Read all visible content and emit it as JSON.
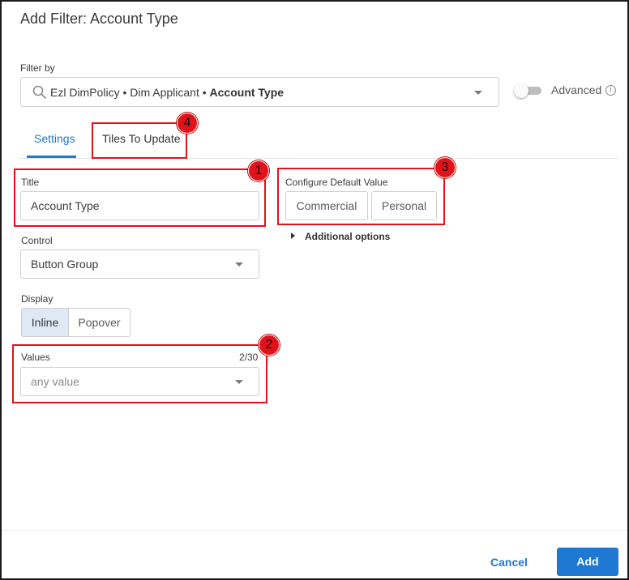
{
  "dialog": {
    "title": "Add Filter: Account Type"
  },
  "filter_by": {
    "label": "Filter by",
    "path_prefix": "Ezl DimPolicy • Dim Applicant • ",
    "path_field": "Account Type",
    "advanced_label": "Advanced",
    "advanced_on": false,
    "info_icon": "i"
  },
  "tabs": [
    {
      "label": "Settings",
      "active": true
    },
    {
      "label": "Tiles To Update",
      "active": false
    }
  ],
  "settings": {
    "title_label": "Title",
    "title_value": "Account Type",
    "control_label": "Control",
    "control_value": "Button Group",
    "display_label": "Display",
    "display_options": [
      "Inline",
      "Popover"
    ],
    "display_selected": "Inline",
    "values_label": "Values",
    "values_count": "2/30",
    "values_placeholder": "any value"
  },
  "default_value": {
    "label": "Configure Default Value",
    "options": [
      "Commercial",
      "Personal"
    ],
    "additional_options": "Additional options"
  },
  "callouts": [
    "1",
    "2",
    "3",
    "4"
  ],
  "footer": {
    "cancel_label": "Cancel",
    "add_label": "Add"
  },
  "colors": {
    "accent": "#1f78d1",
    "callout": "#e3121a",
    "segment_active": "#dfe9f6"
  }
}
